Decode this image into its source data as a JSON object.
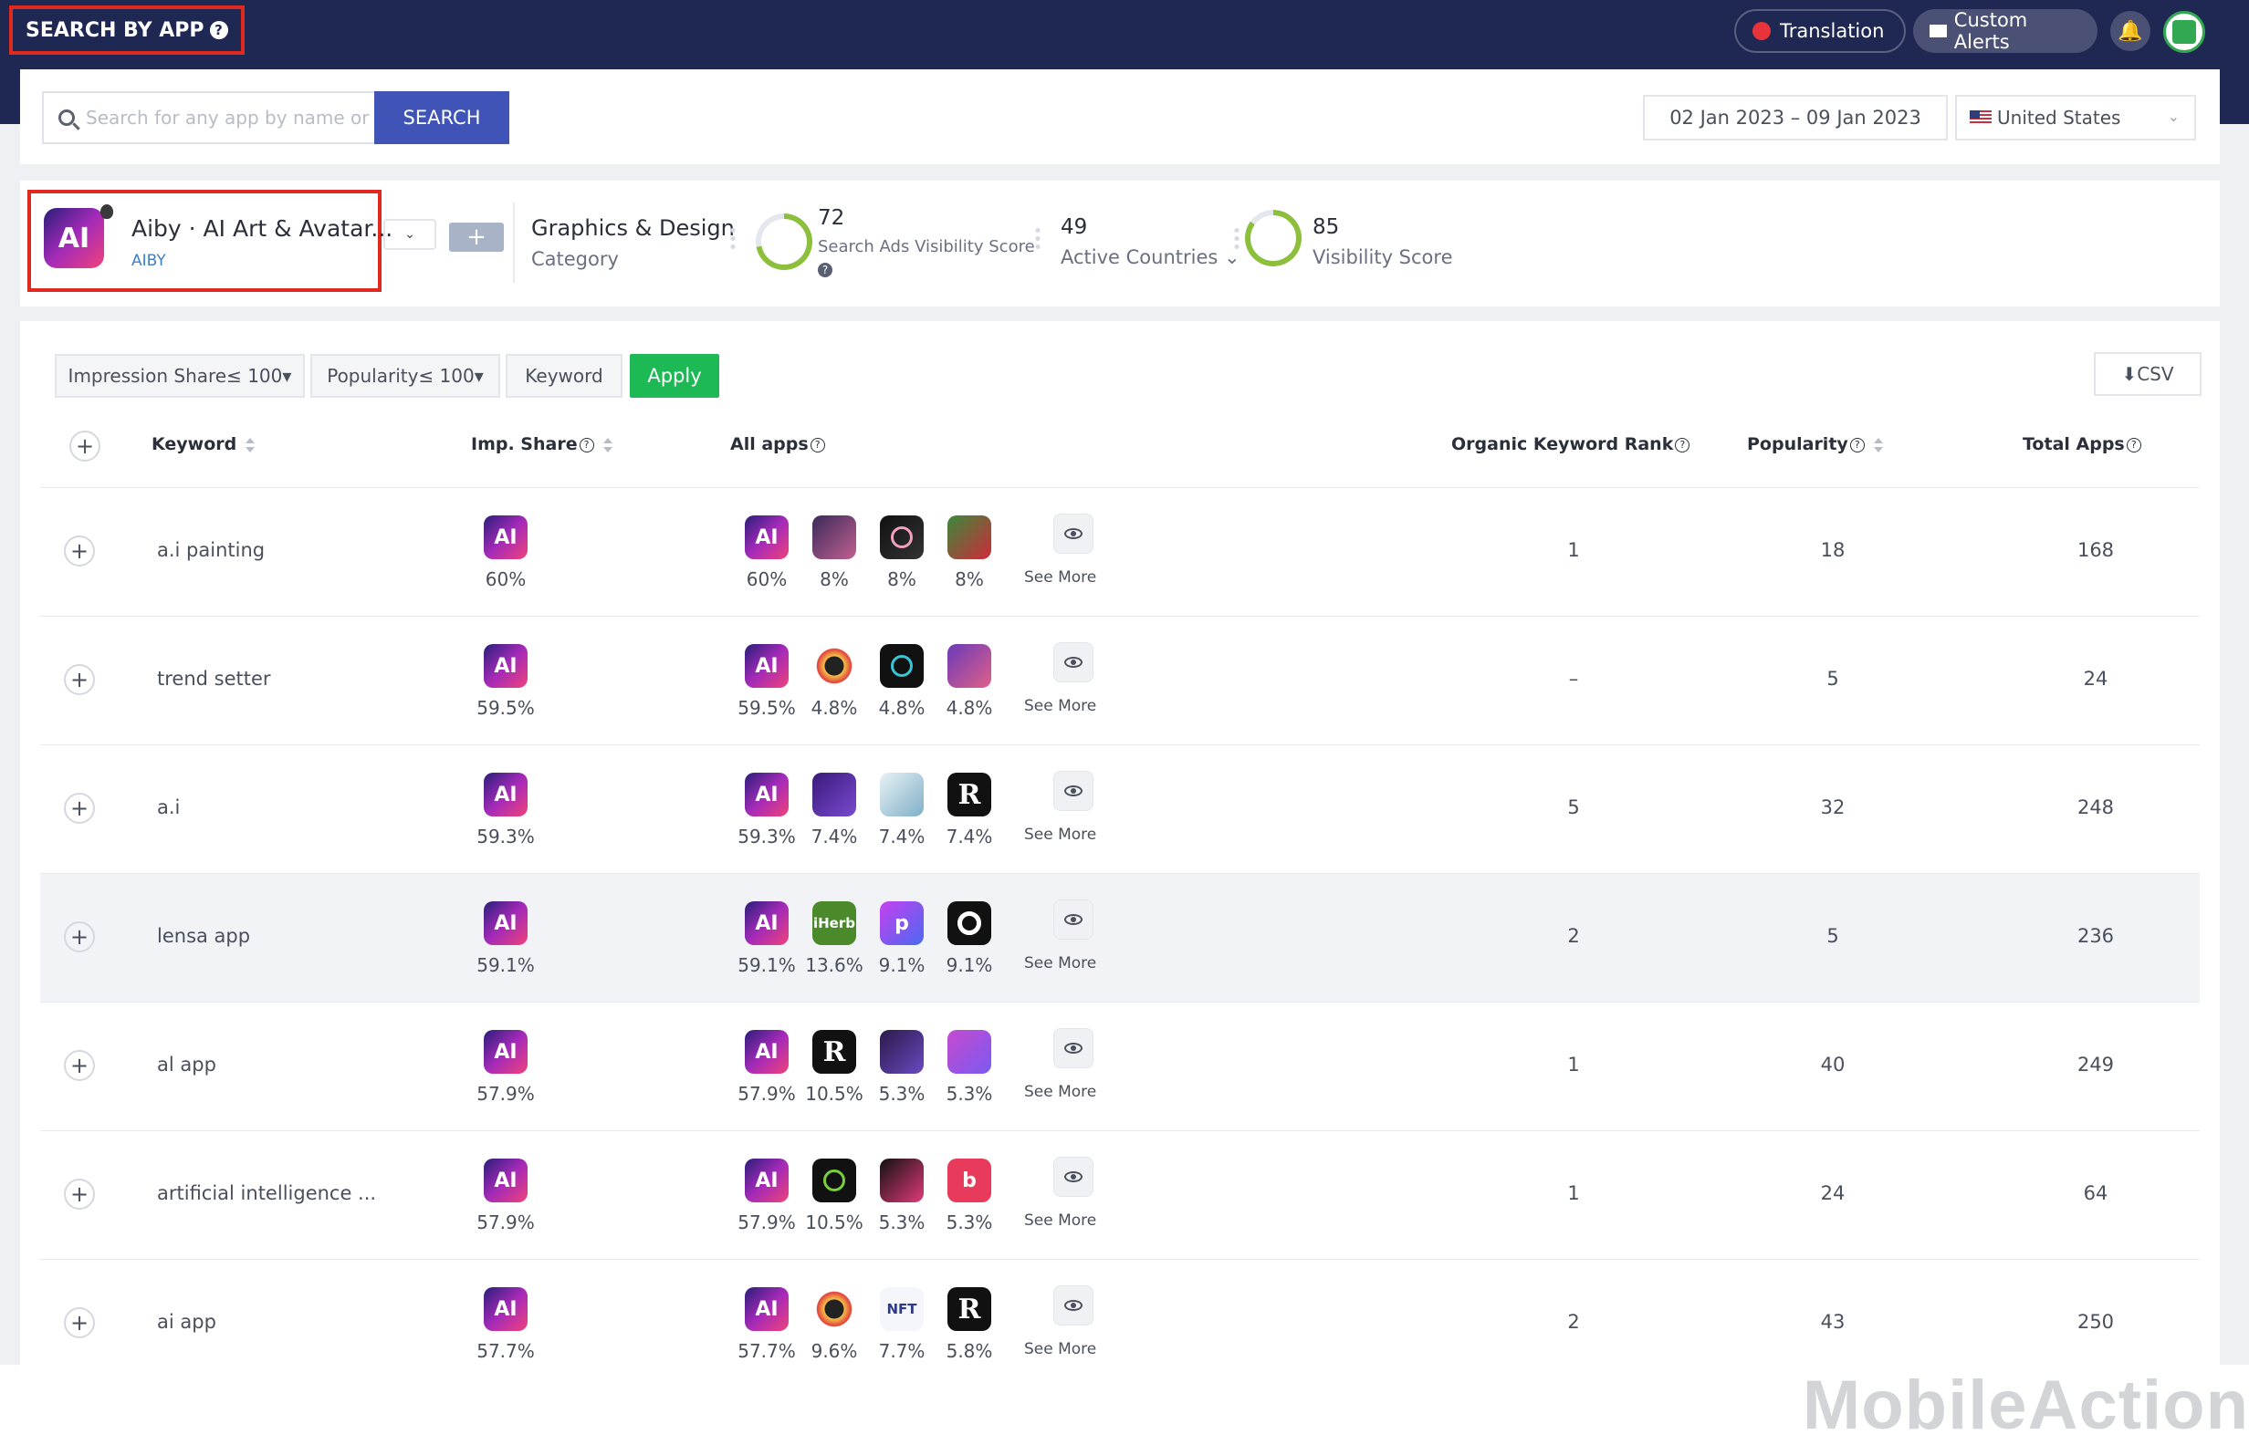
{
  "header": {
    "brand": "SEARCH BY APP",
    "translation": "Translation",
    "custom_alerts": "Custom Alerts",
    "colors": {
      "nav_bg": "#1f2753",
      "highlight": "#e02a20"
    }
  },
  "search": {
    "placeholder": "Search for any app by name or id",
    "button": "SEARCH",
    "date_range": "02 Jan 2023  –  09 Jan 2023",
    "country": "United States"
  },
  "app": {
    "name": "Aiby · AI Art & Avatar...",
    "developer": "AIBY",
    "icon_text": "AI",
    "category_value": "Graphics & Design",
    "category_label": "Category",
    "search_ads_visibility_score": "72",
    "search_ads_visibility_label": "Search Ads Visibility Score",
    "active_countries": "49",
    "active_countries_label": "Active Countries",
    "visibility_score": "85",
    "visibility_label": "Visibility Score"
  },
  "filters": {
    "impression": "Impression Share≤ 100",
    "popularity": "Popularity≤ 100",
    "keyword": "Keyword",
    "apply": "Apply",
    "csv": "CSV"
  },
  "columns": {
    "keyword": "Keyword",
    "imp_share": "Imp. Share",
    "all_apps": "All apps",
    "organic_rank": "Organic Keyword Rank",
    "popularity": "Popularity",
    "total_apps": "Total Apps"
  },
  "see_more": "See More",
  "rows": [
    {
      "keyword": "a.i painting",
      "imp": "60%",
      "apps": [
        "60%",
        "8%",
        "8%",
        "8%"
      ],
      "rank": "1",
      "pop": "18",
      "total": "168"
    },
    {
      "keyword": "trend setter",
      "imp": "59.5%",
      "apps": [
        "59.5%",
        "4.8%",
        "4.8%",
        "4.8%"
      ],
      "rank": "–",
      "pop": "5",
      "total": "24"
    },
    {
      "keyword": "a.i",
      "imp": "59.3%",
      "apps": [
        "59.3%",
        "7.4%",
        "7.4%",
        "7.4%"
      ],
      "rank": "5",
      "pop": "32",
      "total": "248"
    },
    {
      "keyword": "lensa app",
      "imp": "59.1%",
      "apps": [
        "59.1%",
        "13.6%",
        "9.1%",
        "9.1%"
      ],
      "rank": "2",
      "pop": "5",
      "total": "236"
    },
    {
      "keyword": "al app",
      "imp": "57.9%",
      "apps": [
        "57.9%",
        "10.5%",
        "5.3%",
        "5.3%"
      ],
      "rank": "1",
      "pop": "40",
      "total": "249"
    },
    {
      "keyword": "artificial intelligence ...",
      "imp": "57.9%",
      "apps": [
        "57.9%",
        "10.5%",
        "5.3%",
        "5.3%"
      ],
      "rank": "1",
      "pop": "24",
      "total": "64"
    },
    {
      "keyword": "ai app",
      "imp": "57.7%",
      "apps": [
        "57.7%",
        "9.6%",
        "7.7%",
        "5.8%"
      ],
      "rank": "2",
      "pop": "43",
      "total": "250"
    }
  ],
  "icon_texts": {
    "iherb": "iHerb",
    "p": "p",
    "r": "R",
    "nft": "NFT"
  },
  "watermark": "MobileAction"
}
